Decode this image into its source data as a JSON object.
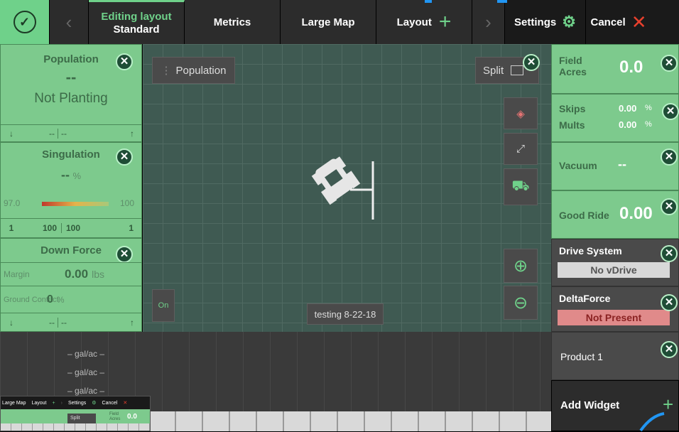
{
  "topbar": {
    "editing_line1": "Editing layout",
    "editing_line2": "Standard",
    "metrics": "Metrics",
    "large_map": "Large Map",
    "layout": "Layout",
    "settings": "Settings",
    "cancel": "Cancel"
  },
  "left": {
    "population": {
      "title": "Population",
      "value": "--",
      "status": "Not Planting",
      "low": "--",
      "high": "--"
    },
    "singulation": {
      "title": "Singulation",
      "value": "--",
      "unit": "%",
      "min": "97.0",
      "max": "100",
      "c1": "1",
      "c2": "100",
      "c3": "100",
      "c4": "1"
    },
    "downforce": {
      "title": "Down Force",
      "margin_label": "Margin",
      "margin_value": "0.00",
      "margin_unit": "lbs",
      "ground_label": "Ground Contact",
      "ground_value": "0",
      "ground_unit": "%",
      "low": "--",
      "high": "--"
    }
  },
  "map": {
    "population_btn": "Population",
    "split_btn": "Split",
    "on_toggle": "On",
    "field_label": "testing 8-22-18"
  },
  "right": {
    "field": {
      "label": "Field Acres",
      "value": "0.0"
    },
    "skips": {
      "label1": "Skips",
      "value1": "0.00",
      "label2": "Mults",
      "value2": "0.00",
      "unit": "%"
    },
    "vacuum": {
      "label": "Vacuum",
      "value": "--"
    },
    "goodride": {
      "label": "Good Ride",
      "value": "0.00"
    },
    "drive": {
      "label": "Drive System",
      "status": "No vDrive"
    },
    "delta": {
      "label": "DeltaForce",
      "status": "Not Present"
    },
    "product": {
      "label": "Product 1"
    },
    "add": {
      "label": "Add Widget"
    }
  },
  "bottom": {
    "rates": [
      "– gal/ac –",
      "– gal/ac –",
      "– gal/ac –"
    ]
  },
  "mini": {
    "large_map": "Large Map",
    "layout": "Layout",
    "settings": "Settings",
    "cancel": "Cancel",
    "split": "Split",
    "field": "Field Acres",
    "value": "0.0"
  },
  "colors": {
    "accent": "#6fd18a",
    "widget_bg": "#7dca8d",
    "danger": "#e8402d"
  }
}
